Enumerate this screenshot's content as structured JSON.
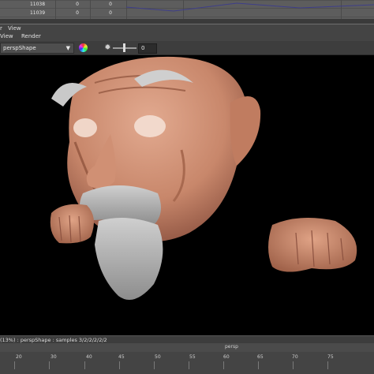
{
  "sheet": {
    "rows": [
      {
        "id": "11038",
        "a": "0",
        "b": "0"
      },
      {
        "id": "11039",
        "a": "0",
        "b": "0"
      }
    ]
  },
  "panel_menu": {
    "items": [
      "r",
      "View"
    ]
  },
  "view_menu": {
    "items": [
      "View",
      "Render"
    ]
  },
  "toolbar": {
    "camera": "perspShape",
    "exposure_value": "0",
    "icons": [
      "color-wheel-icon",
      "exposure-icon"
    ]
  },
  "status": {
    "text": "(13%) : perspShape : samples 3/2/2/2/2/2"
  },
  "timeline": {
    "range_label": "persp",
    "ticks": [
      "20",
      "30",
      "40",
      "45",
      "50",
      "55",
      "60",
      "65",
      "70",
      "75"
    ]
  },
  "colors": {
    "render_bg": "#000000",
    "panel_bg": "#444444",
    "skin": "#c88a6e"
  }
}
